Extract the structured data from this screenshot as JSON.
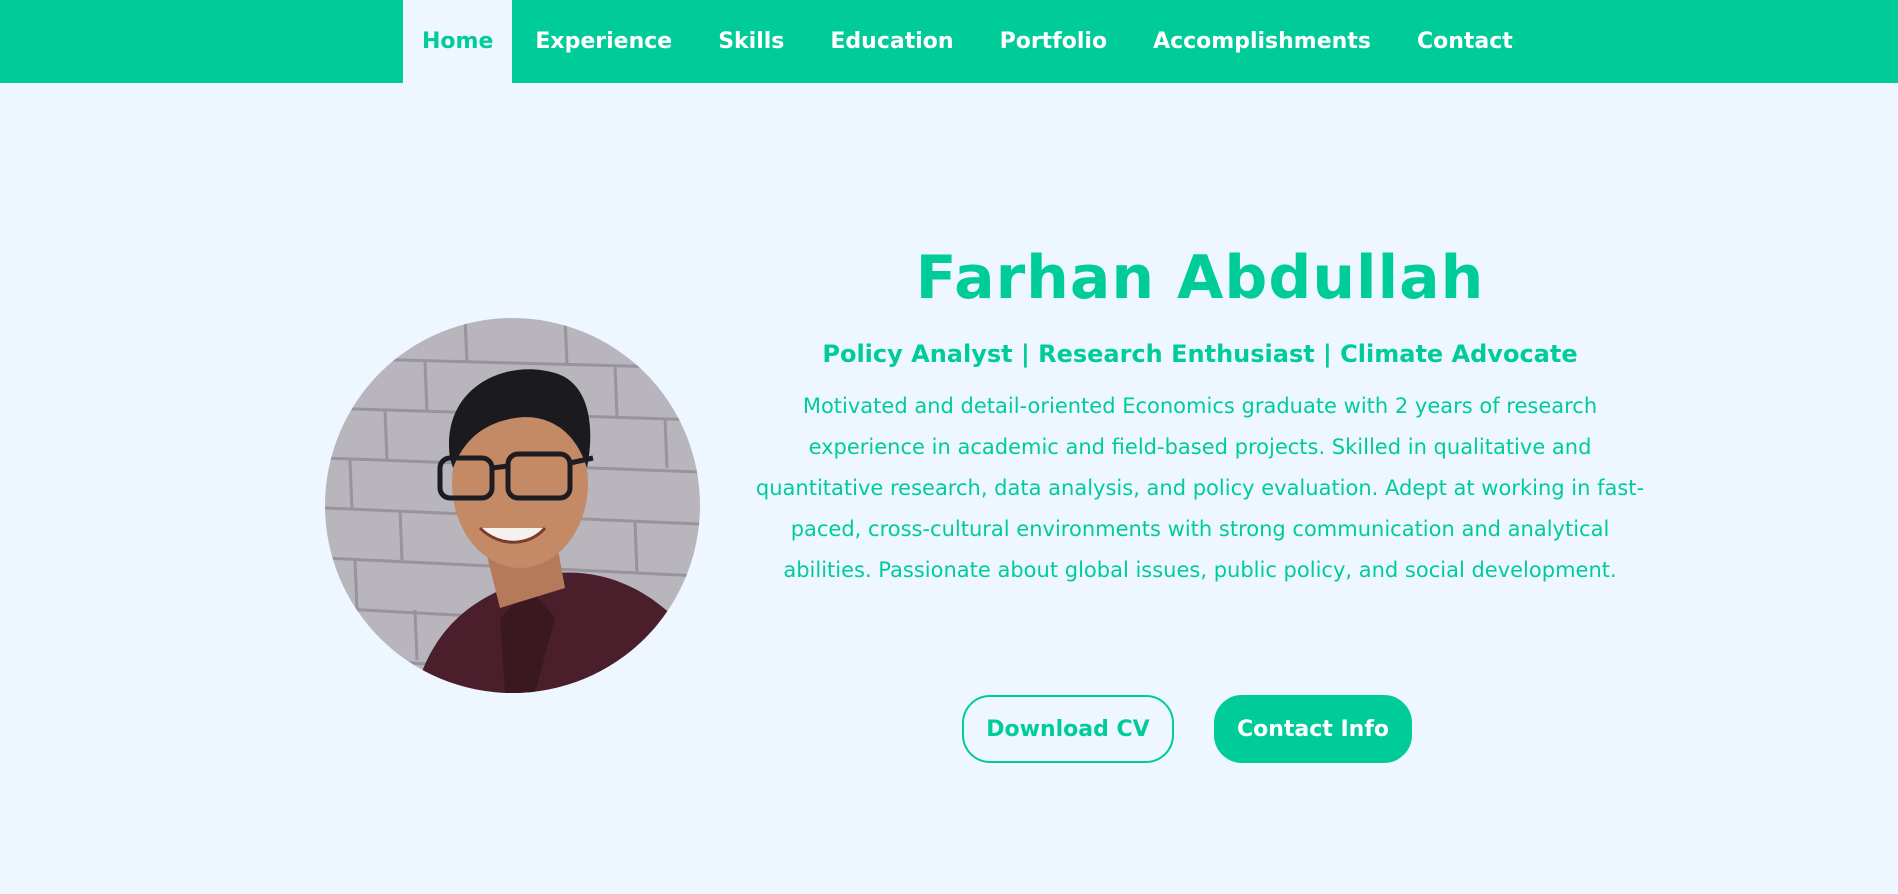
{
  "nav": {
    "items": [
      {
        "label": "Home",
        "active": true
      },
      {
        "label": "Experience"
      },
      {
        "label": "Skills"
      },
      {
        "label": "Education"
      },
      {
        "label": "Portfolio"
      },
      {
        "label": "Accomplishments"
      },
      {
        "label": "Contact"
      }
    ]
  },
  "hero": {
    "name": "Farhan Abdullah",
    "tagline": "Policy Analyst | Research Enthusiast | Climate Advocate",
    "summary": "Motivated and detail-oriented Economics graduate with 2 years of research experience in academic and field-based projects. Skilled in qualitative and quantitative research, data analysis, and policy evaluation. Adept at working in fast-paced, cross-cultural environments with strong communication and analytical abilities. Passionate about global issues, public policy, and social development.",
    "download_cv_label": "Download CV",
    "contact_info_label": "Contact Info"
  },
  "colors": {
    "accent": "#00cc99",
    "background": "#eef7ff",
    "nav_text": "#ffffff"
  }
}
